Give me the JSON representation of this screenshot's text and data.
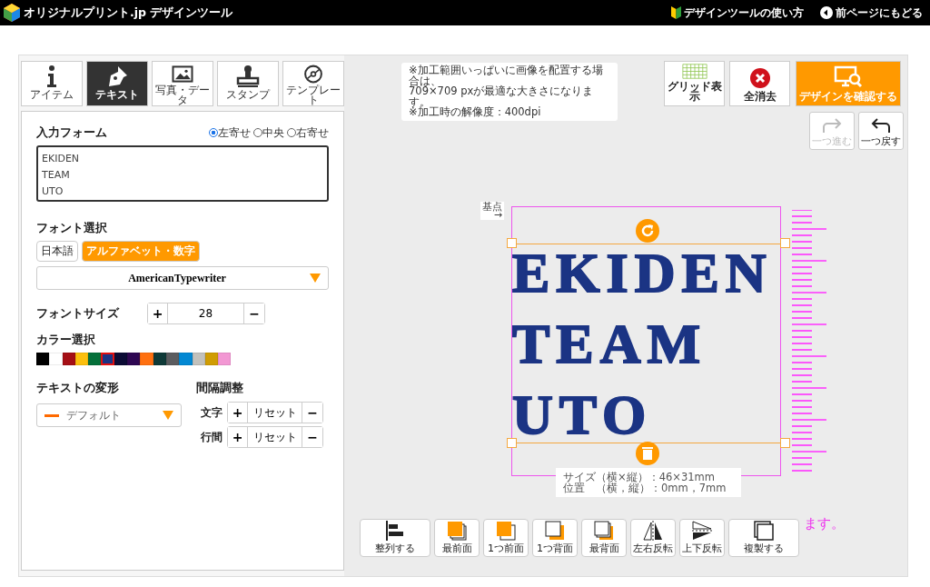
{
  "header": {
    "logo": "オリジナルプリント.jp デザインツール",
    "links": [
      {
        "kind": "guide",
        "label": "デザインツールの使い方"
      },
      {
        "kind": "back",
        "label": "前ページにもどる"
      }
    ]
  },
  "tabs": [
    {
      "kind": "info",
      "label": "アイテム",
      "selected": false
    },
    {
      "kind": "pen",
      "label": "テキスト",
      "selected": true
    },
    {
      "kind": "image",
      "label": "写真・データ",
      "selected": false
    },
    {
      "kind": "stamp",
      "label": "スタンプ",
      "selected": false
    },
    {
      "kind": "template",
      "label": "テンプレート",
      "selected": false
    }
  ],
  "input_form": {
    "title": "入力フォーム",
    "align": [
      {
        "label": "左寄せ",
        "selected": true
      },
      {
        "label": "中央",
        "selected": false
      },
      {
        "label": "右寄せ",
        "selected": false
      }
    ],
    "value": "EKIDEN\nTEAM\nUTO"
  },
  "font": {
    "title": "フォント選択",
    "types": [
      {
        "label": "日本語",
        "selected": false
      },
      {
        "label": "アルファベット・数字",
        "selected": true
      }
    ],
    "selected_font": "AmericanTypewriter"
  },
  "font_size": {
    "label": "フォントサイズ",
    "plus": "+",
    "value": "28",
    "minus": "−"
  },
  "colors": {
    "title": "カラー選択",
    "swatches": [
      {
        "color": "#000000",
        "selected": false
      },
      {
        "color": "#ffffff",
        "selected": false
      },
      {
        "color": "#a50f15",
        "selected": false
      },
      {
        "color": "#fbbf0d",
        "selected": false
      },
      {
        "color": "#04703a",
        "selected": false
      },
      {
        "color": "#1b3484",
        "selected": true
      },
      {
        "color": "#0b0b35",
        "selected": false
      },
      {
        "color": "#2e0752",
        "selected": false
      },
      {
        "color": "#ff7010",
        "selected": false
      },
      {
        "color": "#0f3a38",
        "selected": false
      },
      {
        "color": "#5b5c5f",
        "selected": false
      },
      {
        "color": "#0388d3",
        "selected": false
      },
      {
        "color": "#c2c1bc",
        "selected": false
      },
      {
        "color": "#d09c03",
        "selected": false
      },
      {
        "color": "#f297d3",
        "selected": false
      }
    ]
  },
  "transform": {
    "title": "テキストの変形",
    "value": "デフォルト"
  },
  "spacing": {
    "title": "間隔調整",
    "rows": [
      {
        "label": "文字",
        "plus": "+",
        "reset": "リセット",
        "minus": "−"
      },
      {
        "label": "行間",
        "plus": "+",
        "reset": "リセット",
        "minus": "−"
      }
    ]
  },
  "notice": "※加工範囲いっぱいに画像を配置する場合は、\n709×709 pxが最適な大きさになります。\n※加工時の解像度：400dpi",
  "top_buttons": [
    {
      "kind": "grid",
      "label": "グリッド表示"
    },
    {
      "kind": "clear",
      "label": "全消去"
    },
    {
      "kind": "confirm",
      "label": "デザインを確認する"
    }
  ],
  "history": [
    {
      "kind": "redo",
      "label": "一つ進む",
      "disabled": true
    },
    {
      "kind": "undo",
      "label": "一つ戻す",
      "disabled": false
    }
  ],
  "canvas": {
    "origin": "基点\n→",
    "lines": [
      "EKIDEN",
      "TEAM",
      "UTO"
    ],
    "info": [
      "サイズ（横×縦）：46×31mm",
      "位置　（横，縦）：0mm，7mm"
    ],
    "hidden_note": "ます。"
  },
  "bottom_tools": [
    {
      "kind": "align",
      "label": "整列する"
    },
    {
      "kind": "front",
      "label": "最前面"
    },
    {
      "kind": "forward",
      "label": "1つ前面"
    },
    {
      "kind": "backward",
      "label": "1つ背面"
    },
    {
      "kind": "back",
      "label": "最背面"
    },
    {
      "kind": "fliph",
      "label": "左右反転"
    },
    {
      "kind": "flipv",
      "label": "上下反転"
    },
    {
      "kind": "copy",
      "label": "複製する"
    }
  ]
}
